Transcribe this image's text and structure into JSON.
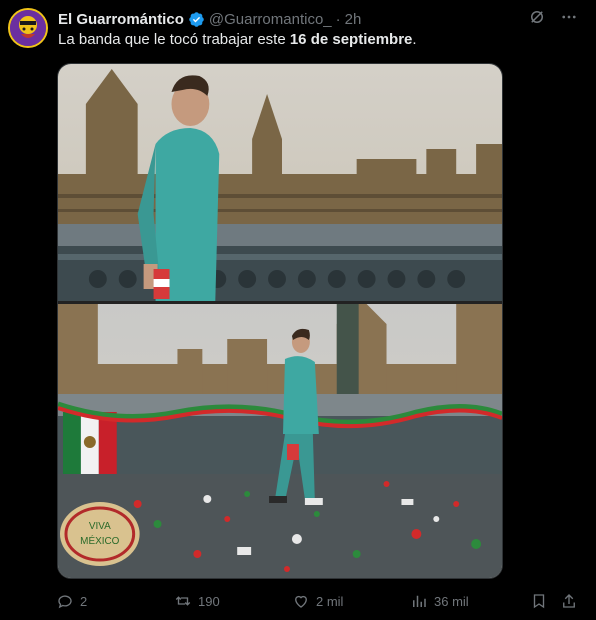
{
  "author": {
    "name": "El Guarromántico",
    "handle": "@Guarromantico_",
    "separator": "·",
    "time": "2h",
    "avatar_icon": "profile-avatar"
  },
  "tweet": {
    "text_before": "La banda que le tocó trabajar este ",
    "text_bold": "16 de septiembre",
    "text_after": "."
  },
  "media": {
    "photos": [
      "photo-man-on-bridge-parliament",
      "photo-man-walking-festive-trash"
    ],
    "sign_text_line1": "VIVA",
    "sign_text_line2": "MÉXICO"
  },
  "actions": {
    "replies": "2",
    "reposts": "190",
    "likes": "2 mil",
    "views": "36 mil"
  },
  "colors": {
    "background": "#000000",
    "text": "#e7e9ea",
    "muted": "#71767b",
    "verified": "#1d9bf0"
  }
}
